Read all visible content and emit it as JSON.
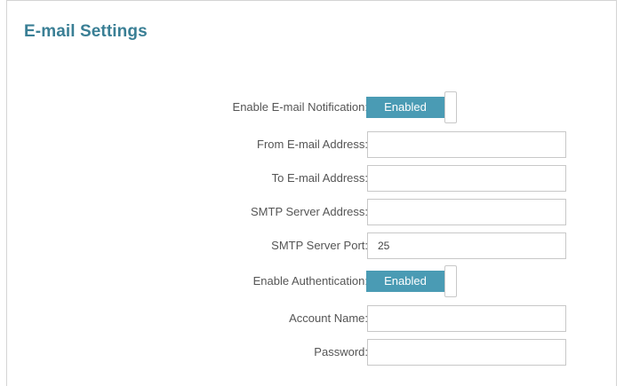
{
  "section": {
    "title": "E-mail Settings"
  },
  "fields": {
    "enable_notification": {
      "label": "Enable E-mail Notification:",
      "state": "Enabled"
    },
    "from_address": {
      "label": "From E-mail Address:",
      "value": ""
    },
    "to_address": {
      "label": "To E-mail Address:",
      "value": ""
    },
    "smtp_server": {
      "label": "SMTP Server Address:",
      "value": ""
    },
    "smtp_port": {
      "label": "SMTP Server Port:",
      "value": "25"
    },
    "enable_auth": {
      "label": "Enable Authentication:",
      "state": "Enabled"
    },
    "account_name": {
      "label": "Account Name:",
      "value": ""
    },
    "password": {
      "label": "Password:",
      "value": ""
    }
  },
  "colors": {
    "title": "#3a7f95",
    "toggle_on": "#4a9bb4",
    "input_border": "#c8c8c8",
    "label_text": "#555555"
  }
}
